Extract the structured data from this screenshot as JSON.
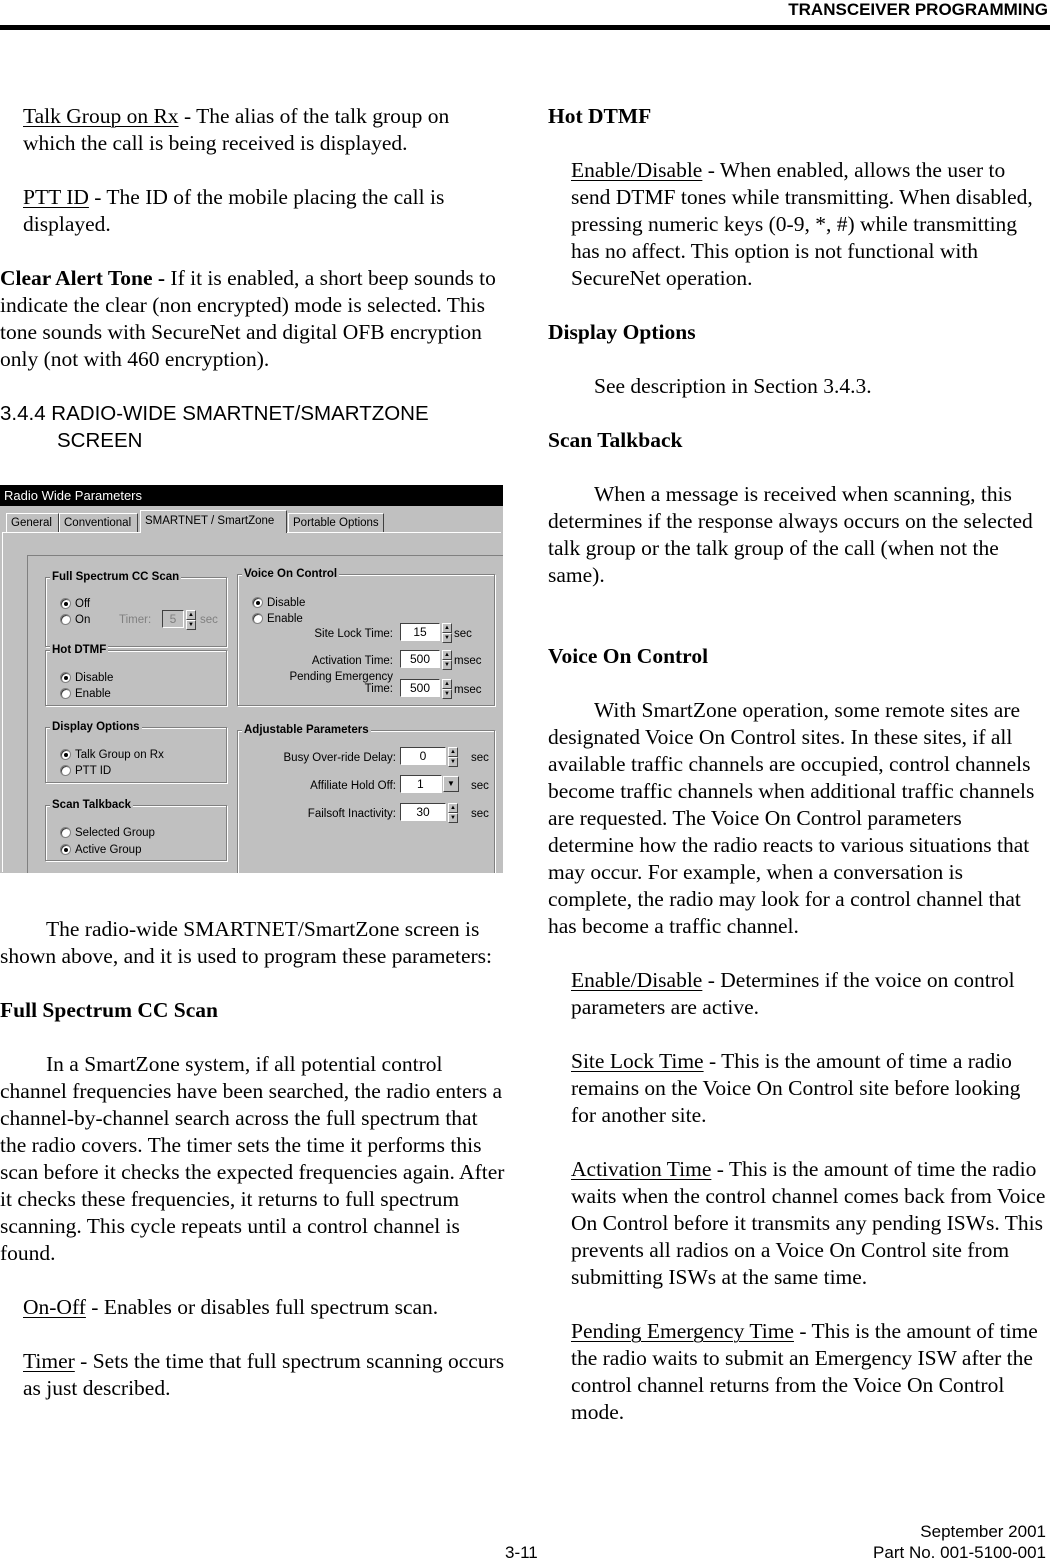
{
  "header": {
    "title": "TRANSCEIVER PROGRAMMING"
  },
  "left": {
    "talk_group_term": "Talk Group on Rx",
    "talk_group_desc": " - The alias of the talk group on which the call is being received is displayed.",
    "ptt_term": "PTT ID",
    "ptt_desc": " - The ID of the mobile placing the call is displayed.",
    "clear_alert_term": "Clear Alert Tone -",
    "clear_alert_desc": " If it is enabled, a short beep sounds to indicate the clear (non encrypted) mode is selected. This tone sounds with SecureNet and digital OFB encryption only (not with 460 encryption).",
    "section_heading_line1": "3.4.4 RADIO-WIDE SMARTNET/SMARTZONE",
    "section_heading_line2": "SCREEN",
    "intro": "The radio-wide SMARTNET/SmartZone screen is shown above, and it is used to program these parameters:",
    "fscc_heading": "Full Spectrum CC Scan",
    "fscc_desc": "In a SmartZone system, if all potential control channel frequencies have been searched, the radio enters a channel-by-channel search across the full spectrum that the radio covers. The timer sets the time it performs this scan before it checks the expected frequencies again. After it checks these frequencies, it returns to full spectrum scanning. This cycle repeats until a control channel is found.",
    "onoff_term": "On-Off",
    "onoff_desc": " - Enables or disables full spectrum scan.",
    "timer_term": "Timer",
    "timer_desc": " - Sets the time that full spectrum scanning occurs as just described."
  },
  "dialog": {
    "title": "Radio Wide Parameters",
    "tabs": [
      {
        "label": "General",
        "active": false
      },
      {
        "label": "Conventional",
        "active": false
      },
      {
        "label": "SMARTNET / SmartZone",
        "active": true
      },
      {
        "label": "Portable Options",
        "active": false
      }
    ],
    "full_spectrum": {
      "label": "Full Spectrum CC Scan",
      "options": [
        "Off",
        "On"
      ],
      "selected": "Off",
      "timer_label": "Timer:",
      "timer_value": "5",
      "timer_unit": "sec"
    },
    "hot_dtmf": {
      "label": "Hot DTMF",
      "options": [
        "Disable",
        "Enable"
      ],
      "selected": "Disable"
    },
    "display_options": {
      "label": "Display Options",
      "options": [
        "Talk Group on Rx",
        "PTT ID"
      ],
      "selected": "Talk Group on Rx"
    },
    "scan_talkback": {
      "label": "Scan Talkback",
      "options": [
        "Selected Group",
        "Active Group"
      ],
      "selected": "Active Group"
    },
    "voice_on_control": {
      "label": "Voice On Control",
      "options": [
        "Disable",
        "Enable"
      ],
      "selected": "Disable",
      "site_lock_label": "Site Lock Time:",
      "site_lock_value": "15",
      "site_lock_unit": "sec",
      "activation_label": "Activation Time:",
      "activation_value": "500",
      "activation_unit": "msec",
      "pending_label_line1": "Pending Emergency",
      "pending_label_line2": "Time:",
      "pending_value": "500",
      "pending_unit": "msec"
    },
    "adjustable": {
      "label": "Adjustable Parameters",
      "busy_label": "Busy Over-ride Delay:",
      "busy_value": "0",
      "busy_unit": "sec",
      "affiliate_label": "Affiliate Hold Off:",
      "affiliate_value": "1",
      "affiliate_unit": "sec",
      "failsoft_label": "Failsoft Inactivity:",
      "failsoft_value": "30",
      "failsoft_unit": "sec"
    }
  },
  "right": {
    "hot_dtmf_heading": "Hot DTMF",
    "hot_dtmf_term": "Enable/Disable",
    "hot_dtmf_desc": " - When enabled, allows the user to send DTMF tones while transmitting. When disabled, pressing numeric keys (0-9, *, #) while transmitting has no affect. This option is not functional with SecureNet operation.",
    "display_heading": "Display Options",
    "display_desc": "See description in Section 3.4.3.",
    "scan_heading": "Scan Talkback",
    "scan_desc": "When a message is received when scanning, this determines if the response always occurs on the selected talk group or the talk group of the call (when not the same).",
    "voc_heading": "Voice On Control",
    "voc_desc": "With SmartZone operation, some remote sites are designated Voice On Control sites. In these sites, if all available traffic channels are occupied, control channels become traffic channels when additional traffic channels are requested. The Voice On Control parameters determine how the radio reacts to various situations that may occur. For example, when a conversation is complete, the radio may look for a control channel that has become a traffic channel.",
    "enable_term": "Enable/Disable",
    "enable_desc": " - Determines if the voice on control parameters are active.",
    "site_lock_term": "Site Lock Time",
    "site_lock_desc": " - This is the amount of time a radio remains on the Voice On Control site before looking for another site.",
    "activation_term": "Activation Time",
    "activation_desc": " - This is the amount of time the radio waits when the control channel comes back from Voice On Control before it transmits any pending ISWs. This prevents all radios on a Voice On Control site from submitting ISWs at the same time.",
    "pending_term": "Pending Emergency Time",
    "pending_desc": " - This is the amount of time the radio waits to submit an Emergency ISW after the control channel returns from the Voice On Control mode."
  },
  "footer": {
    "date": "September 2001",
    "page": "3-11",
    "part": "Part No. 001-5100-001"
  }
}
